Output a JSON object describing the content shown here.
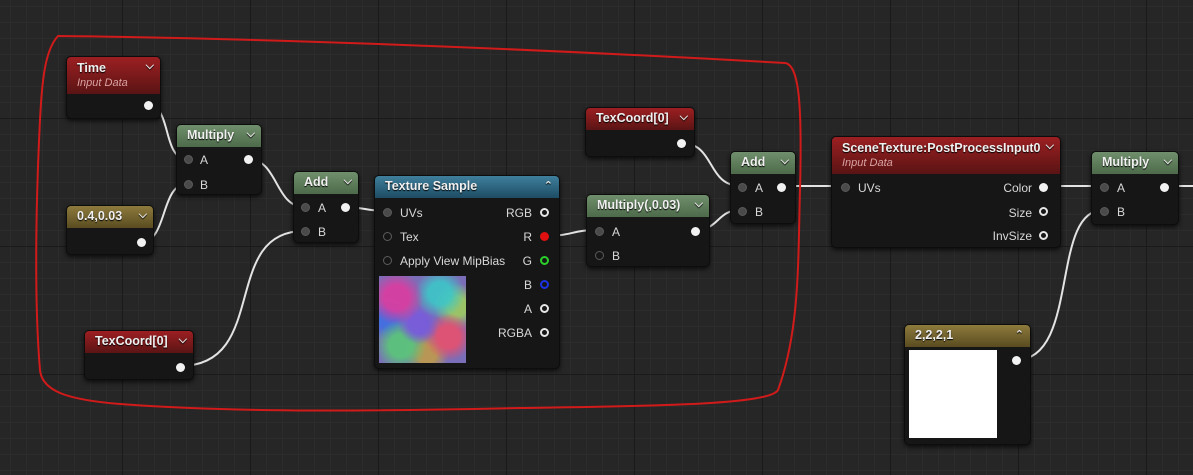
{
  "nodes": {
    "time": {
      "title": "Time",
      "subtitle": "Input Data"
    },
    "multiply1": {
      "title": "Multiply",
      "pin_a": "A",
      "pin_b": "B"
    },
    "const1": {
      "title": "0.4,0.03"
    },
    "texcoord1": {
      "title": "TexCoord[0]"
    },
    "add1": {
      "title": "Add",
      "pin_a": "A",
      "pin_b": "B"
    },
    "texsample": {
      "title": "Texture Sample",
      "inputs": [
        "UVs",
        "Tex",
        "Apply View MipBias"
      ],
      "outputs": [
        "RGB",
        "R",
        "G",
        "B",
        "A",
        "RGBA"
      ]
    },
    "multiply2": {
      "title": "Multiply(,0.03)",
      "pin_a": "A",
      "pin_b": "B"
    },
    "texcoord2": {
      "title": "TexCoord[0]"
    },
    "add2": {
      "title": "Add",
      "pin_a": "A",
      "pin_b": "B"
    },
    "scenetex": {
      "title": "SceneTexture:PostProcessInput0",
      "subtitle": "Input Data",
      "input": "UVs",
      "outputs": [
        "Color",
        "Size",
        "InvSize"
      ]
    },
    "multiply3": {
      "title": "Multiply",
      "pin_a": "A",
      "pin_b": "B"
    },
    "const4": {
      "title": "2,2,2,1"
    }
  },
  "icons": {
    "collapse": "chevron-down-icon",
    "expand": "chevron-up-icon"
  },
  "colors": {
    "annotation": "#d11a1a",
    "wire": "#e8e8e8",
    "header_math": "#5d7d5a",
    "header_input": "#7e1a1c",
    "header_constant": "#746430",
    "header_texture": "#2e6680"
  }
}
